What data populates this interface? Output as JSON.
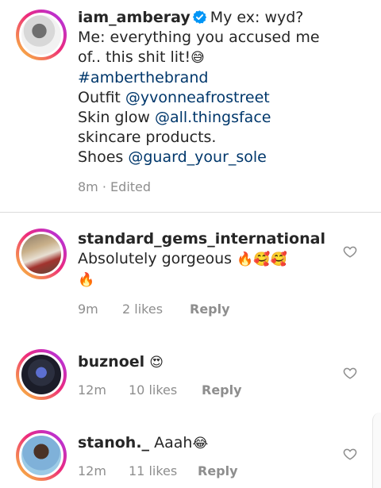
{
  "caption": {
    "username": "iam_amberay",
    "text_intro": "My ex: wyd?",
    "line2": "Me: everything you accused me",
    "line3": "of.. this shit lit!",
    "line3_emoji": "😅",
    "hashtag": "#amberthebrand",
    "outfit_label": "Outfit",
    "outfit_mention": "@yvonneafrostreet",
    "skin_label": "Skin glow",
    "skin_mention": "@all.thingsface",
    "skin_suffix": "skincare products.",
    "shoes_label": "Shoes",
    "shoes_mention": "@guard_your_sole",
    "time": "8m",
    "separator": "·",
    "edited": "Edited",
    "verified_icon": "verified-badge-icon",
    "verified_color": "#0095f6"
  },
  "comments": [
    {
      "username": "standard_gems_international",
      "text": "Absolutely gorgeous",
      "emoji": "🔥🥰🥰",
      "emoji_line2": "🔥",
      "time": "9m",
      "likes": "2 likes",
      "reply": "Reply"
    },
    {
      "username": "buznoel",
      "text": "",
      "emoji": "😍",
      "time": "12m",
      "likes": "10 likes",
      "reply": "Reply"
    },
    {
      "username": "stanoh._",
      "text": "Aaah",
      "emoji": "😂",
      "time": "12m",
      "likes": "11 likes",
      "reply": "Reply"
    }
  ],
  "colors": {
    "mention": "#00376b",
    "meta": "#8e8e8e",
    "divider": "#dbdbdb"
  }
}
